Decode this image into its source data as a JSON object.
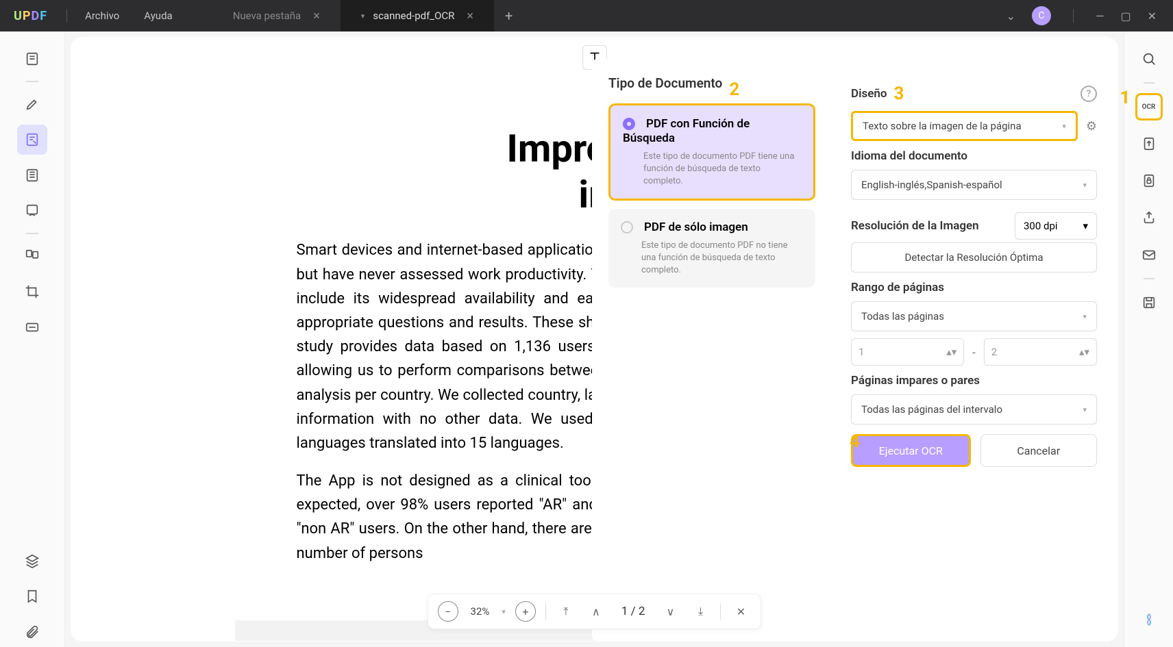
{
  "titlebar": {
    "menus": {
      "file": "Archivo",
      "help": "Ayuda"
    },
    "tabs": {
      "new": "Nueva pestaña",
      "current": "scanned-pdf_OCR"
    },
    "avatar": "C"
  },
  "page": {
    "title_line1": "Improve V",
    "title_line2": "in",
    "para1": "Smart devices and internet-based applications (apps) are already used in rhinitis (24-27) but have never assessed work productivity. The strengths of this new mobile technology include its widespread availability and easy use, but there is a need for selecting appropriate questions and results. These should be assessed by pilot studies. This pilot study provides data based on 1,136 users who filled in the survey using MASK-VAS allowing us to perform comparisons between the outcomes, but not to make subgroup analysis per country. We collected country, language, and device type and date of entry of information with no other data. We used very simple questions translated into 15 languages translated into 15 languages.",
    "para2": "The App is not designed as a clinical tool but rather as not a clinical trial. Thus, as expected, over 98% users reported \"AR\" and we are unable to assess the responses of \"non AR\" users. On the other hand, there are many days with no symptoms in a sufficient number of persons"
  },
  "ocr_left": {
    "title": "Tipo de Documento",
    "opt1_title": "PDF con Función de Búsqueda",
    "opt1_desc": "Este tipo de documento PDF tiene una función de búsqueda de texto completo.",
    "opt2_title": "PDF de sólo imagen",
    "opt2_desc": "Este tipo de documento PDF no tiene una función de búsqueda de texto completo."
  },
  "ocr_right": {
    "design_label": "Diseño",
    "design_value": "Texto sobre la imagen de la página",
    "lang_label": "Idioma del documento",
    "lang_value": "English-inglés,Spanish-español",
    "res_label": "Resolución de la Imagen",
    "res_value": "300 dpi",
    "detect_btn": "Detectar la Resolución Óptima",
    "range_label": "Rango de páginas",
    "range_value": "Todas las páginas",
    "range_from": "1",
    "range_to": "2",
    "oddeven_label": "Páginas impares o pares",
    "oddeven_value": "Todas las páginas del intervalo",
    "execute": "Ejecutar OCR",
    "cancel": "Cancelar"
  },
  "bottom": {
    "zoom": "32%",
    "page": "1",
    "total": "2"
  },
  "callouts": {
    "c1": "1",
    "c2": "2",
    "c3": "3",
    "c4": "4"
  }
}
